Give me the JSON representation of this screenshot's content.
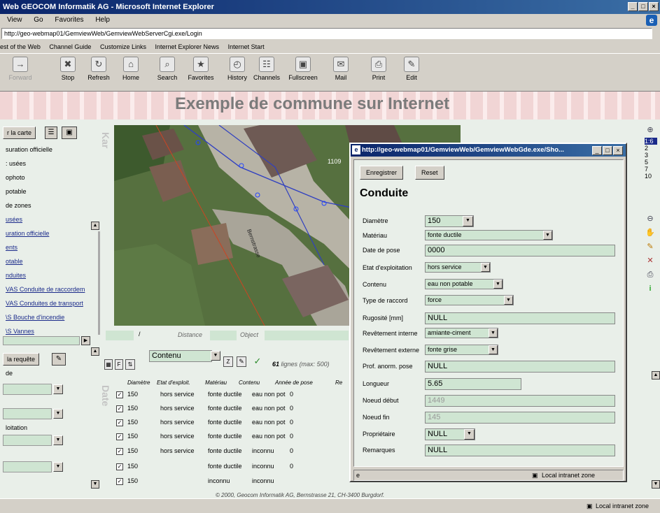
{
  "window": {
    "title": "Web GEOCOM Informatik AG - Microsoft Internet Explorer",
    "controls": [
      "_",
      "□",
      "×"
    ]
  },
  "menu": [
    "View",
    "Go",
    "Favorites",
    "Help"
  ],
  "address": "http://geo-webmap01/GemviewWeb/GemviewWebServerCgi.exe/Login",
  "links": [
    "est of the Web",
    "Channel Guide",
    "Customize Links",
    "Internet Explorer News",
    "Internet Start"
  ],
  "toolbar": [
    {
      "label": "Forward",
      "icon": "→"
    },
    {
      "label": "Stop",
      "icon": "✖"
    },
    {
      "label": "Refresh",
      "icon": "↻"
    },
    {
      "label": "Home",
      "icon": "⌂"
    },
    {
      "label": "Search",
      "icon": "⌕"
    },
    {
      "label": "Favorites",
      "icon": "★"
    },
    {
      "label": "History",
      "icon": "◴"
    },
    {
      "label": "Channels",
      "icon": "☷"
    },
    {
      "label": "Fullscreen",
      "icon": "▣"
    },
    {
      "label": "Mail",
      "icon": "✉"
    },
    {
      "label": "Print",
      "icon": "⎙"
    },
    {
      "label": "Edit",
      "icon": "✎"
    }
  ],
  "page": {
    "title": "Exemple de commune sur Internet",
    "map_button": "r la carte",
    "layers": [
      {
        "label": "suration officielle",
        "link": false
      },
      {
        "label": ": usées",
        "link": false
      },
      {
        "label": "ophoto",
        "link": false
      },
      {
        "label": "potable",
        "link": false
      },
      {
        "label": "de zones",
        "link": false
      },
      {
        "label": "usées",
        "link": true
      },
      {
        "label": "uration officielle",
        "link": true
      },
      {
        "label": "ents",
        "link": true
      },
      {
        "label": "otable",
        "link": true
      },
      {
        "label": "nduites",
        "link": true
      },
      {
        "label": "VAS Conduite de raccordem",
        "link": true
      },
      {
        "label": "VAS Conduites de transport",
        "link": true
      },
      {
        "label": "\\S Bouche d'incendie",
        "link": true
      },
      {
        "label": "\\S Vannes",
        "link": true
      }
    ],
    "query_button": "la requête",
    "query_labels": [
      "de",
      "loitation"
    ],
    "side_label_map": "Kar",
    "side_label_data": "Date",
    "map_labels": {
      "distance": "Distance",
      "object": "Object",
      "slash": "/",
      "house": "1109",
      "street": "Bernstrasse"
    },
    "zoom_levels": [
      "1:6",
      "2",
      "3",
      "5",
      "7",
      "10"
    ],
    "footer": "© 2000, Geocom Informatik AG, Bernstrasse 21, CH-3400 Burgdorf."
  },
  "table": {
    "dropdown": "Contenu",
    "count": "61",
    "count_label": "lignes",
    "max": "(max: 500)",
    "headers": [
      "Diamètre",
      "Etat d'exploit.",
      "Matériau",
      "Contenu",
      "Année de pose",
      "Re"
    ],
    "rows": [
      {
        "d": "150",
        "etat": "hors service",
        "mat": "fonte ductile",
        "cont": "eau non pot",
        "annee": "0"
      },
      {
        "d": "150",
        "etat": "hors service",
        "mat": "fonte ductile",
        "cont": "eau non pot",
        "annee": "0"
      },
      {
        "d": "150",
        "etat": "hors service",
        "mat": "fonte ductile",
        "cont": "eau non pot",
        "annee": "0"
      },
      {
        "d": "150",
        "etat": "hors service",
        "mat": "fonte ductile",
        "cont": "eau non pot",
        "annee": "0"
      },
      {
        "d": "150",
        "etat": "hors service",
        "mat": "fonte ductile",
        "cont": "inconnu",
        "annee": "0"
      },
      {
        "d": "150",
        "etat": "",
        "mat": "fonte ductile",
        "cont": "inconnu",
        "annee": "0"
      },
      {
        "d": "150",
        "etat": "",
        "mat": "inconnu",
        "cont": "inconnu",
        "annee": ""
      }
    ]
  },
  "dialog": {
    "title": "http://geo-webmap01/GemviewWeb/GemviewWebGde.exe/Sho...",
    "save": "Enregistrer",
    "reset": "Reset",
    "heading": "Conduite",
    "fields": [
      {
        "label": "Diamètre",
        "value": "150",
        "kind": "select"
      },
      {
        "label": "Matériau",
        "value": "fonte ductile",
        "kind": "select"
      },
      {
        "label": "Date de pose",
        "value": "0000",
        "kind": "text"
      },
      {
        "label": "Etat d'exploitation",
        "value": "hors service",
        "kind": "select"
      },
      {
        "label": "Contenu",
        "value": "eau non potable",
        "kind": "select"
      },
      {
        "label": "Type de raccord",
        "value": "force",
        "kind": "select"
      },
      {
        "label": "Rugosité [mm]",
        "value": "NULL",
        "kind": "text"
      },
      {
        "label": "Revêtement interne",
        "value": "amiante-ciment",
        "kind": "select"
      },
      {
        "label": "Revêtement externe",
        "value": "fonte grise",
        "kind": "select"
      },
      {
        "label": "Prof. anorm. pose",
        "value": "NULL",
        "kind": "text"
      },
      {
        "label": "Longueur",
        "value": "5.65",
        "kind": "text"
      },
      {
        "label": "Noeud début",
        "value": "1449",
        "kind": "disabled"
      },
      {
        "label": "Noeud fin",
        "value": "145",
        "kind": "disabled"
      },
      {
        "label": "Propriétaire",
        "value": "NULL",
        "kind": "select"
      },
      {
        "label": "Remarques",
        "value": "NULL",
        "kind": "text"
      }
    ],
    "status_zone": "Local intranet zone"
  },
  "status": {
    "zone": "Local intranet zone"
  }
}
